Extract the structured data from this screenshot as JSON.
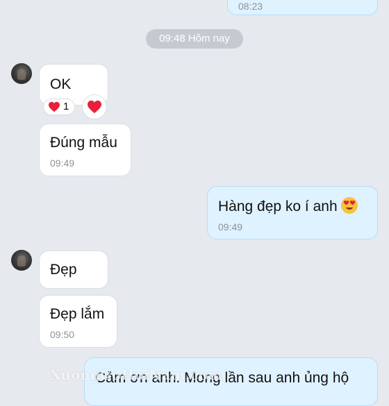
{
  "date_separator": "09:48 Hôm nay",
  "messages": [
    {
      "text": "",
      "time": "08:23"
    },
    {
      "text": "OK",
      "time": ""
    },
    {
      "text": "Đúng mẫu",
      "time": "09:49"
    },
    {
      "text": "Hàng đẹp ko í anh",
      "time": "09:49"
    },
    {
      "text": "Đẹp",
      "time": ""
    },
    {
      "text": "Đẹp lắm",
      "time": "09:50"
    },
    {
      "text": "Cảm ơn anh. Mong lần sau anh ủng hộ",
      "time": ""
    }
  ],
  "reaction": {
    "count": "1",
    "icon": "heart-icon"
  },
  "watermark": "XuongGoHoiNam.com",
  "colors": {
    "background": "#e6e9ee",
    "incoming_bubble": "#ffffff",
    "outgoing_bubble": "#dff2ff",
    "heart": "#e8203a"
  }
}
